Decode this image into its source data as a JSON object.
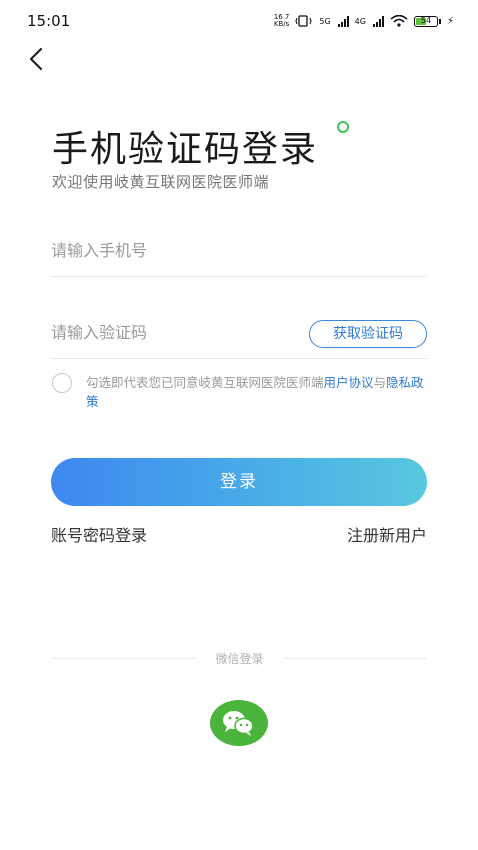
{
  "status_bar": {
    "time": "15:01",
    "net_speed_value": "16.7",
    "net_speed_unit": "KB/s",
    "sig1_label": "5G",
    "sig2_label": "4G",
    "battery": "54",
    "battery_level": 0.54
  },
  "header": {
    "title": "手机验证码登录",
    "subtitle": "欢迎使用岐黄互联网医院医师端"
  },
  "form": {
    "phone_placeholder": "请输入手机号",
    "phone_value": "",
    "code_placeholder": "请输入验证码",
    "code_value": "",
    "get_code_label": "获取验证码"
  },
  "agreement": {
    "prefix": "勾选即代表您已同意岐黄互联网医院医师端",
    "user_agreement": "用户协议",
    "conjunction": "与",
    "privacy_policy": "隐私政策"
  },
  "actions": {
    "login_label": "登录",
    "password_login": "账号密码登录",
    "register": "注册新用户"
  },
  "third_party": {
    "wechat_label": "微信登录"
  },
  "colors": {
    "accent": "#2f7bd0",
    "button_gradient_start": "#3d88f0",
    "button_gradient_end": "#58c8de",
    "wechat_green": "#4ab43c"
  },
  "icons": [
    "back-arrow-icon",
    "wifi-icon",
    "signal-icon",
    "battery-icon",
    "wechat-icon"
  ]
}
